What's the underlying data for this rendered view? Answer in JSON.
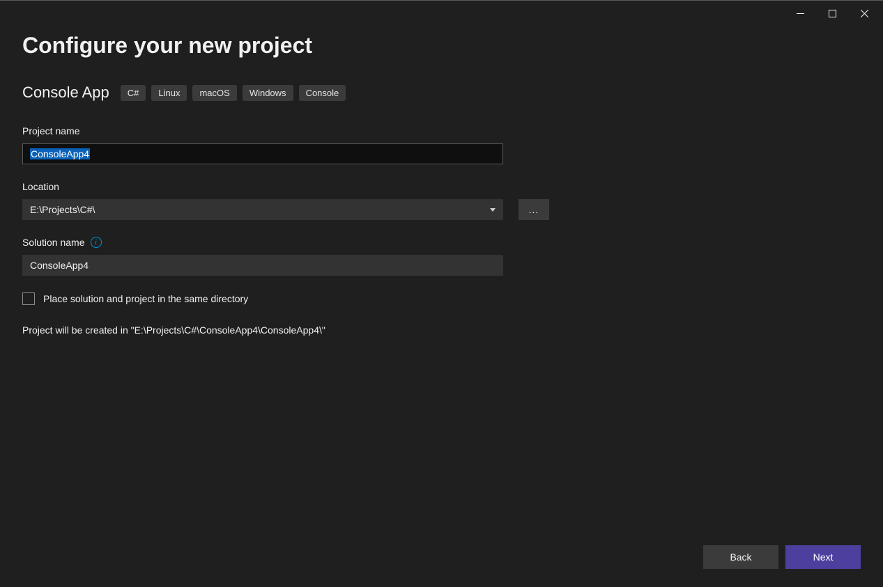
{
  "header": {
    "title": "Configure your new project"
  },
  "template": {
    "name": "Console App",
    "tags": [
      "C#",
      "Linux",
      "macOS",
      "Windows",
      "Console"
    ]
  },
  "fields": {
    "project_name": {
      "label": "Project name",
      "value": "ConsoleApp4"
    },
    "location": {
      "label": "Location",
      "value": "E:\\Projects\\C#\\",
      "browse_label": "..."
    },
    "solution_name": {
      "label": "Solution name",
      "value": "ConsoleApp4"
    },
    "same_directory": {
      "checked": false,
      "label": "Place solution and project in the same directory"
    }
  },
  "footer": {
    "creation_path_text": "Project will be created in \"E:\\Projects\\C#\\ConsoleApp4\\ConsoleApp4\\\""
  },
  "actions": {
    "back": "Back",
    "next": "Next"
  }
}
